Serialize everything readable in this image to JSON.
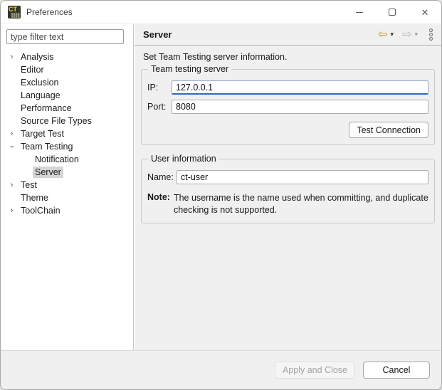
{
  "window": {
    "title": "Preferences",
    "controls": {
      "close_glyph": "✕"
    }
  },
  "icons": {
    "tree_chevron": "›",
    "back_arrow": "⇦",
    "forward_arrow": "⇨",
    "caret_down": "▾"
  },
  "sidebar": {
    "filter_placeholder": "type filter text",
    "tree": [
      {
        "label": "Analysis",
        "level": 0,
        "state": "collapsed",
        "selected": false
      },
      {
        "label": "Editor",
        "level": 0,
        "state": "none",
        "selected": false
      },
      {
        "label": "Exclusion",
        "level": 0,
        "state": "none",
        "selected": false
      },
      {
        "label": "Language",
        "level": 0,
        "state": "none",
        "selected": false
      },
      {
        "label": "Performance",
        "level": 0,
        "state": "none",
        "selected": false
      },
      {
        "label": "Source File Types",
        "level": 0,
        "state": "none",
        "selected": false
      },
      {
        "label": "Target Test",
        "level": 0,
        "state": "collapsed",
        "selected": false
      },
      {
        "label": "Team Testing",
        "level": 0,
        "state": "expanded",
        "selected": false
      },
      {
        "label": "Notification",
        "level": 1,
        "state": "none",
        "selected": false
      },
      {
        "label": "Server",
        "level": 1,
        "state": "none",
        "selected": true
      },
      {
        "label": "Test",
        "level": 0,
        "state": "collapsed",
        "selected": false
      },
      {
        "label": "Theme",
        "level": 0,
        "state": "none",
        "selected": false
      },
      {
        "label": "ToolChain",
        "level": 0,
        "state": "collapsed",
        "selected": false
      }
    ]
  },
  "content": {
    "title": "Server",
    "description": "Set Team Testing server information.",
    "server_group": {
      "legend": "Team testing server",
      "ip_label": "IP:",
      "ip_value": "127.0.0.1",
      "port_label": "Port:",
      "port_value": "8080",
      "test_button": "Test Connection"
    },
    "user_group": {
      "legend": "User information",
      "name_label": "Name:",
      "name_value": "ct-user",
      "note_label": "Note:",
      "note_text": "The username is the name used when committing, and duplicate checking is not supported."
    }
  },
  "footer": {
    "apply_label": "Apply and Close",
    "cancel_label": "Cancel"
  }
}
